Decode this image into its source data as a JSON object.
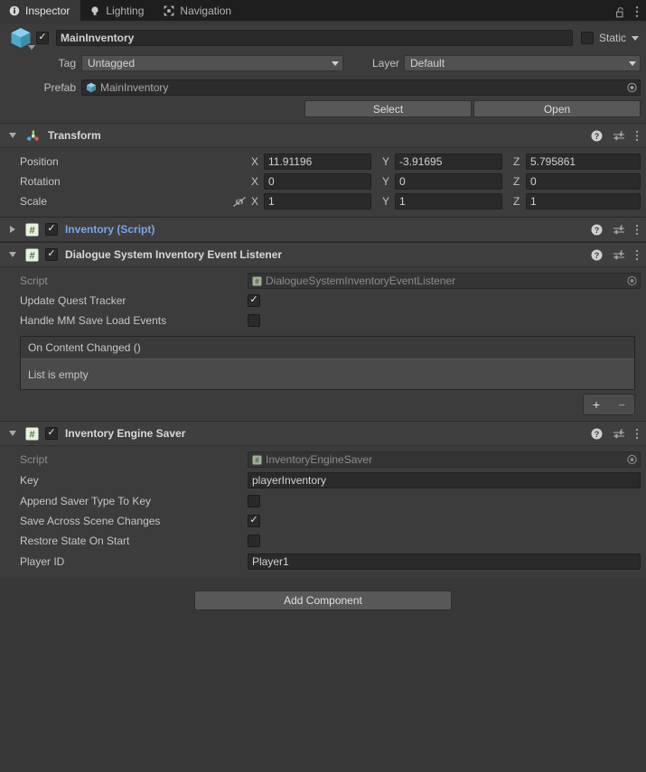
{
  "window": {
    "tabs": [
      {
        "label": "Inspector",
        "icon": "info-icon",
        "active": true
      },
      {
        "label": "Lighting",
        "icon": "lightbulb-icon",
        "active": false
      },
      {
        "label": "Navigation",
        "icon": "navigation-icon",
        "active": false
      }
    ],
    "lock_icon": "lock-open-icon",
    "menu_icon": "kebab-menu-icon"
  },
  "game_object": {
    "icon": "prefab-cube-icon",
    "enabled": true,
    "name": "MainInventory",
    "static_label": "Static",
    "static_checked": false,
    "tag_label": "Tag",
    "tag_value": "Untagged",
    "layer_label": "Layer",
    "layer_value": "Default",
    "prefab_label": "Prefab",
    "prefab_value": "MainInventory",
    "select_button": "Select",
    "open_button": "Open"
  },
  "transform": {
    "title": "Transform",
    "icon": "transform-gizmo-icon",
    "expanded": true,
    "enabled": null,
    "rows": [
      {
        "label": "Position",
        "x": "11.91196",
        "y": "-3.91695",
        "z": "5.795861"
      },
      {
        "label": "Rotation",
        "x": "0",
        "y": "0",
        "z": "0"
      },
      {
        "label": "Scale",
        "x": "1",
        "y": "1",
        "z": "1",
        "constrain_icon": "link-broken-icon"
      }
    ],
    "axis_labels": [
      "X",
      "Y",
      "Z"
    ]
  },
  "inventory_script": {
    "title": "Inventory (Script)",
    "icon": "script-icon",
    "expanded": false,
    "enabled": true
  },
  "dialogue_listener": {
    "title": "Dialogue System Inventory Event Listener",
    "icon": "script-icon",
    "expanded": true,
    "enabled": true,
    "script_label": "Script",
    "script_value": "DialogueSystemInventoryEventListener",
    "properties": [
      {
        "label": "Update Quest Tracker",
        "checked": true
      },
      {
        "label": "Handle MM Save Load Events",
        "checked": false
      }
    ],
    "event": {
      "title": "On Content Changed ()",
      "empty_text": "List is empty",
      "add_button": "+",
      "remove_button": "−"
    }
  },
  "inventory_engine_saver": {
    "title": "Inventory Engine Saver",
    "icon": "script-icon",
    "expanded": true,
    "enabled": true,
    "script_label": "Script",
    "script_value": "InventoryEngineSaver",
    "key_label": "Key",
    "key_value": "playerInventory",
    "properties": [
      {
        "label": "Append Saver Type To Key",
        "checked": false
      },
      {
        "label": "Save Across Scene Changes",
        "checked": true
      },
      {
        "label": "Restore State On Start",
        "checked": false
      }
    ],
    "player_id_label": "Player ID",
    "player_id_value": "Player1"
  },
  "add_component_button": "Add Component",
  "colors": {
    "panel_bg": "#383838",
    "component_bg": "#3c3c3c",
    "field_bg": "#2a2a2a",
    "script_link": "#7ba6e8",
    "text": "#c4c4c4"
  }
}
